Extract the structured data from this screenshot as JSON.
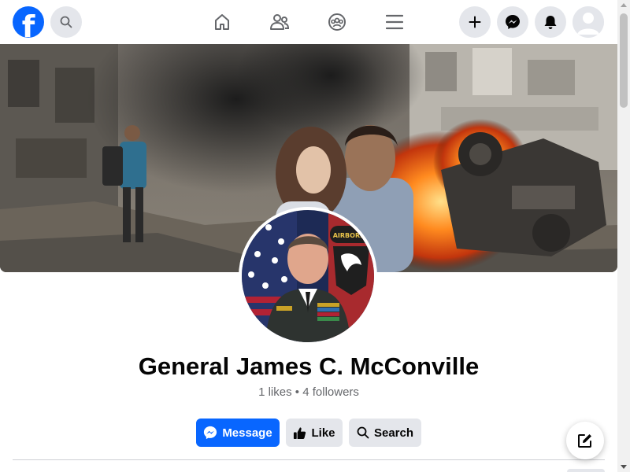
{
  "topbar": {
    "logo_letter": "f",
    "icons": {
      "search": "search-icon",
      "home": "home-icon",
      "friends": "friends-icon",
      "groups": "groups-icon",
      "menu": "menu-icon",
      "create": "plus-icon",
      "messenger": "messenger-icon",
      "notifications": "bell-icon",
      "account": "avatar-icon"
    }
  },
  "profile": {
    "name": "General James C. McConville",
    "likes": "1 likes",
    "separator": "•",
    "followers": "4 followers",
    "patch_text": "AIRBORNE"
  },
  "actions": {
    "message_label": "Message",
    "like_label": "Like",
    "search_label": "Search"
  },
  "colors": {
    "brand": "#0866ff",
    "button_gray": "#e4e6eb",
    "text_secondary": "#65676b"
  }
}
